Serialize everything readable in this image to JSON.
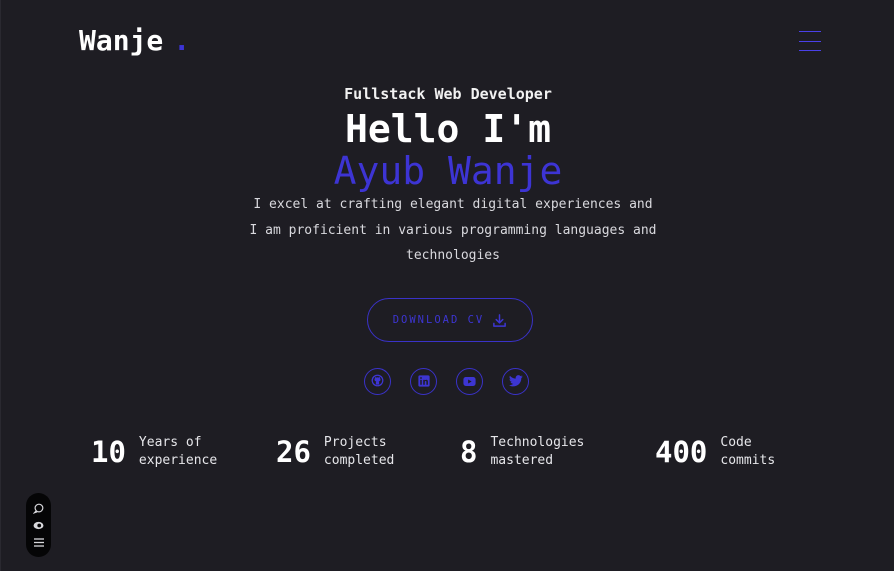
{
  "brand": {
    "name": "Wanje",
    "dot": ".",
    "accent_color": "#3c34d6"
  },
  "nav": {
    "menu_icon": "hamburger-icon"
  },
  "hero": {
    "subtitle": "Fullstack Web Developer",
    "greeting": "Hello I'm",
    "name": "Ayub Wanje",
    "description_lines": [
      "I excel at crafting elegant digital experiences and",
      "I am proficient in various programming languages and",
      "technologies"
    ]
  },
  "cv_button": {
    "label": "DOWNLOAD CV",
    "icon": "download-icon"
  },
  "socials": [
    {
      "name": "github",
      "icon": "github-icon"
    },
    {
      "name": "linkedin",
      "icon": "linkedin-icon"
    },
    {
      "name": "youtube",
      "icon": "youtube-icon"
    },
    {
      "name": "twitter",
      "icon": "twitter-icon"
    }
  ],
  "stats": [
    {
      "value": "10",
      "label_line1": "Years of",
      "label_line2": "experience"
    },
    {
      "value": "26",
      "label_line1": "Projects",
      "label_line2": "completed"
    },
    {
      "value": "8",
      "label_line1": "Technologies",
      "label_line2": "mastered"
    },
    {
      "value": "400",
      "label_line1": "Code",
      "label_line2": "commits"
    }
  ],
  "floating_toolbar": {
    "icons": [
      "comment-icon",
      "eye-icon",
      "menu-lines-icon"
    ]
  },
  "colors": {
    "background": "#1e1d23",
    "accent": "#3c34d6",
    "text": "#ffffff"
  }
}
